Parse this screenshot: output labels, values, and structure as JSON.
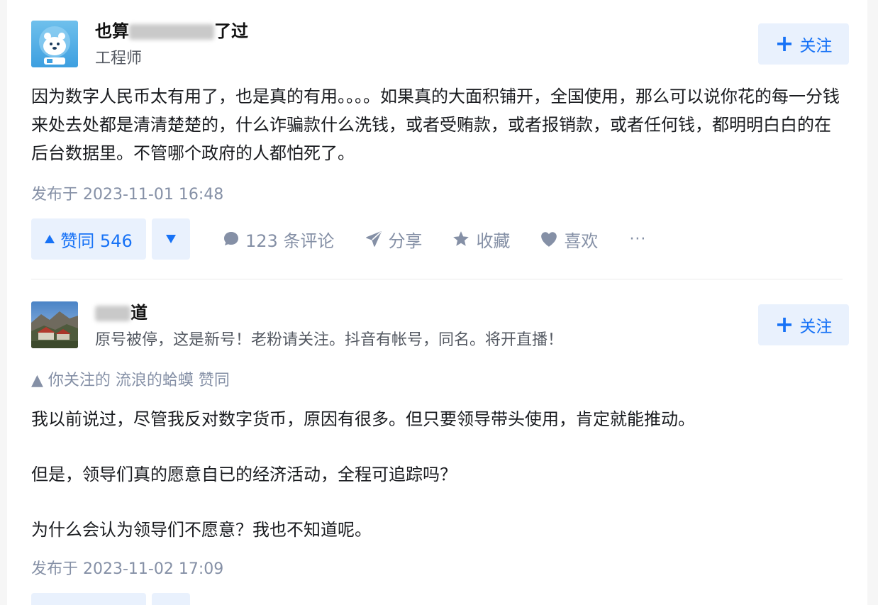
{
  "answers": [
    {
      "author": {
        "name_visible_start": "也算",
        "name_visible_end": "了过",
        "headline": "工程师"
      },
      "follow_label": "关注",
      "paragraphs": [
        "因为数字人民币太有用了，也是真的有用。。。。如果真的大面积铺开，全国使用，那么可以说你花的每一分钱来处去处都是清清楚楚的，什么诈骗款什么洗钱，或者受贿款，或者报销款，或者任何钱，都明明白白的在后台数据里。不管哪个政府的人都怕死了。"
      ],
      "time": "发布于 2023-11-01 16:48",
      "vote_up_label": "赞同 546",
      "comment_label": "123 条评论",
      "share_label": "分享",
      "collect_label": "收藏",
      "like_label": "喜欢",
      "more_label": "···"
    },
    {
      "author": {
        "name_visible_start": "",
        "name_visible_end": "道",
        "headline": "原号被停，这是新号！老粉请关注。抖音有帐号，同名。将开直播！"
      },
      "follow_label": "关注",
      "voted_by": "▲ 你关注的 流浪的蛤蟆 赞同",
      "paragraphs": [
        "我以前说过，尽管我反对数字货币，原因有很多。但只要领导带头使用，肯定就能推动。",
        "但是，领导们真的愿意自已的经济活动，全程可追踪吗？",
        "为什么会认为领导们不愿意？我也不知道呢。"
      ],
      "time": "发布于 2023-11-02 17:09"
    }
  ],
  "colors": {
    "accent": "#1772f6",
    "accent_bg": "#e9f1fd",
    "meta": "#8590a6"
  }
}
